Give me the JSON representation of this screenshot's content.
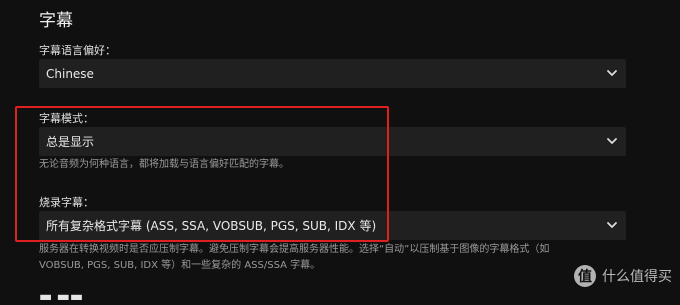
{
  "section": {
    "title": "字幕"
  },
  "language_pref": {
    "label": "字幕语言偏好：",
    "value": "Chinese"
  },
  "subtitle_mode": {
    "label": "字幕模式：",
    "value": "总是显示",
    "help": "无论音频为何种语言，都将加载与语言偏好匹配的字幕。"
  },
  "burn_in": {
    "label": "烧录字幕：",
    "value": "所有复杂格式字幕 (ASS, SSA, VOBSUB, PGS, SUB, IDX 等)",
    "help_lines": [
      "服务器在转换视频时是否应压制字幕。避免压制字幕会提高服务器性能。选择“自动”以压制基于图像的字幕格式（如",
      "VOBSUB, PGS, SUB, IDX 等）和一些复杂的 ASS/SSA 字幕。"
    ]
  },
  "watermark": {
    "badge": "值",
    "text": "什么值得买"
  },
  "icons": {
    "dropdown": "chevron-down-icon"
  }
}
